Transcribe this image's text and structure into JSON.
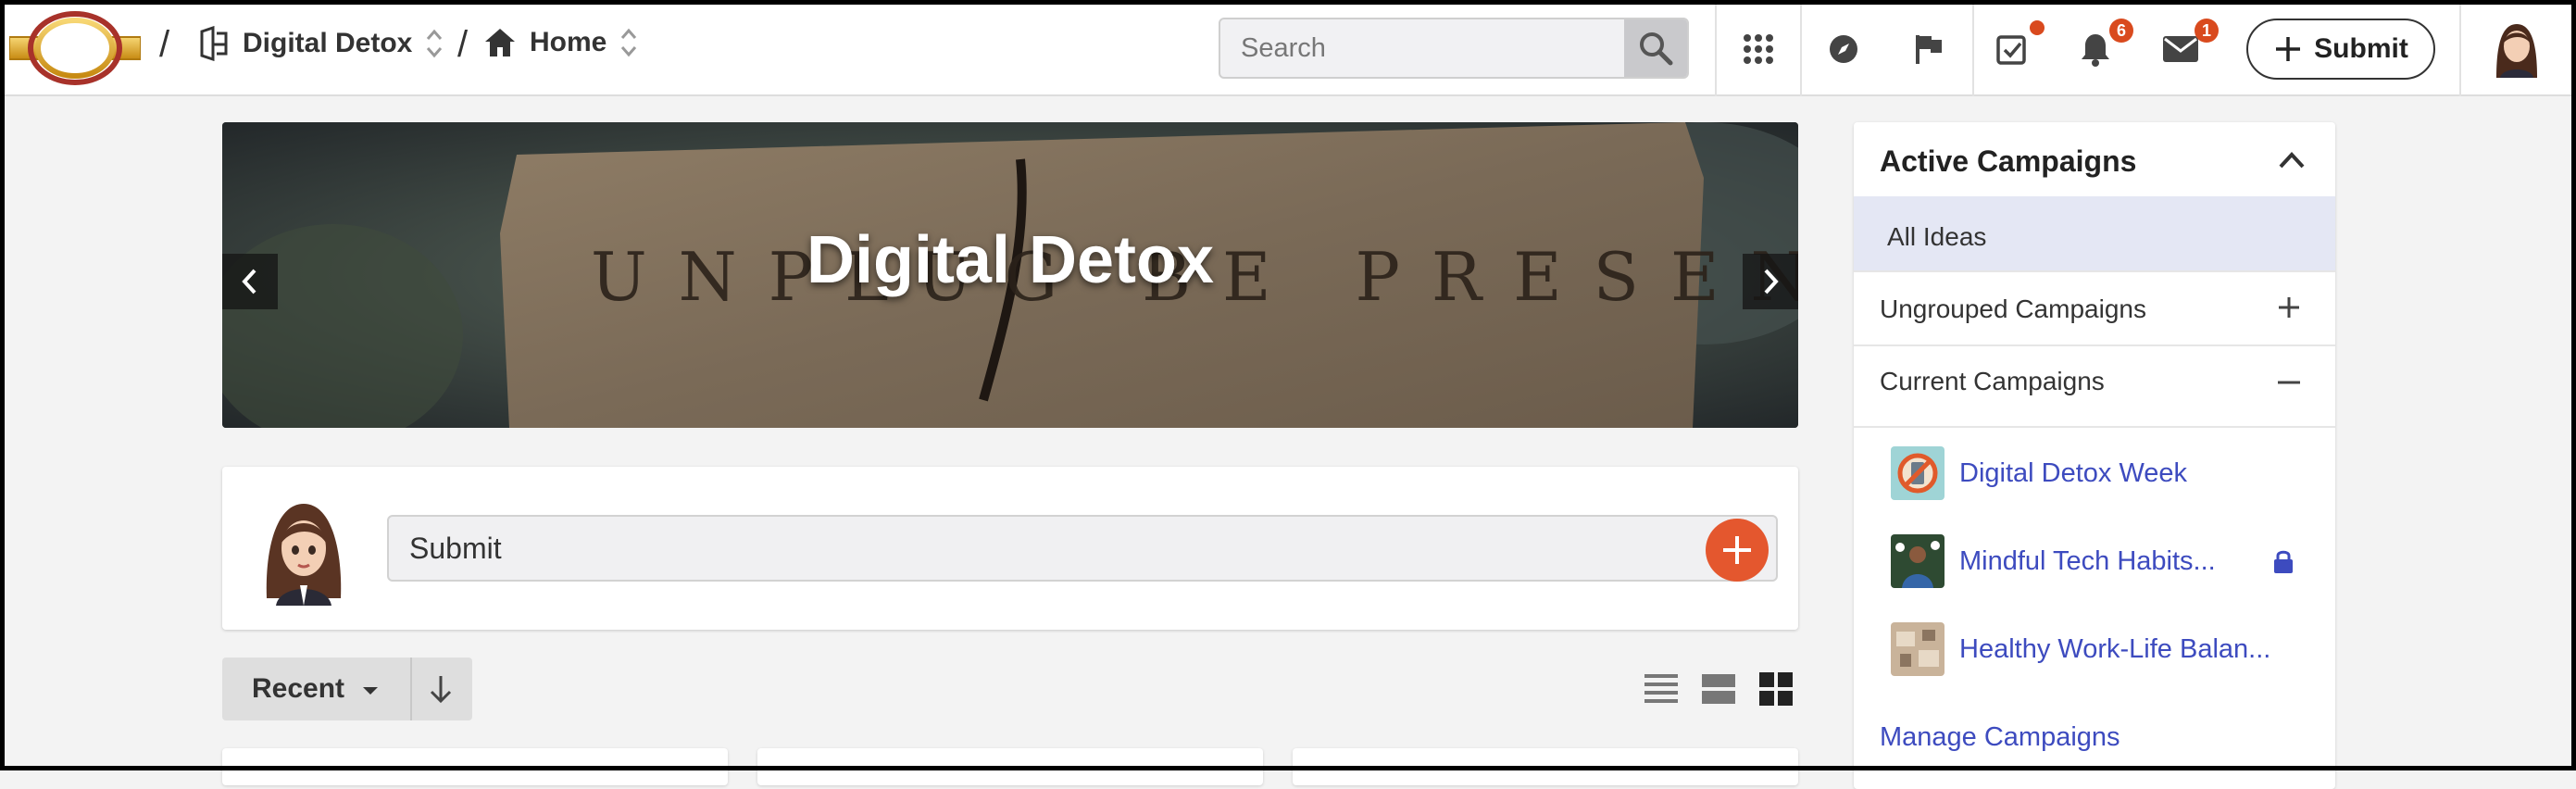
{
  "breadcrumb": {
    "separator": "/",
    "community": "Digital Detox",
    "page": "Home"
  },
  "search": {
    "placeholder": "Search"
  },
  "notifications": {
    "alerts_count": "6",
    "messages_count": "1"
  },
  "submit_button": {
    "label": "Submit"
  },
  "banner": {
    "title": "Digital Detox",
    "carved_text": "UNPLUG BE PRESENT"
  },
  "composer": {
    "placeholder": "Submit"
  },
  "sort": {
    "label": "Recent"
  },
  "campaigns": {
    "heading": "Active Campaigns",
    "all_ideas": "All Ideas",
    "ungrouped": "Ungrouped Campaigns",
    "current": "Current Campaigns",
    "items": [
      {
        "name": "Digital Detox Week",
        "locked": false
      },
      {
        "name": "Mindful Tech Habits...",
        "locked": true
      },
      {
        "name": "Healthy Work-Life Balan...",
        "locked": false
      }
    ],
    "manage": "Manage Campaigns"
  },
  "colors": {
    "accent": "#e4572e",
    "badge": "#d94a1e",
    "link": "#3d4bbf",
    "active_row": "#e4e7f4"
  }
}
